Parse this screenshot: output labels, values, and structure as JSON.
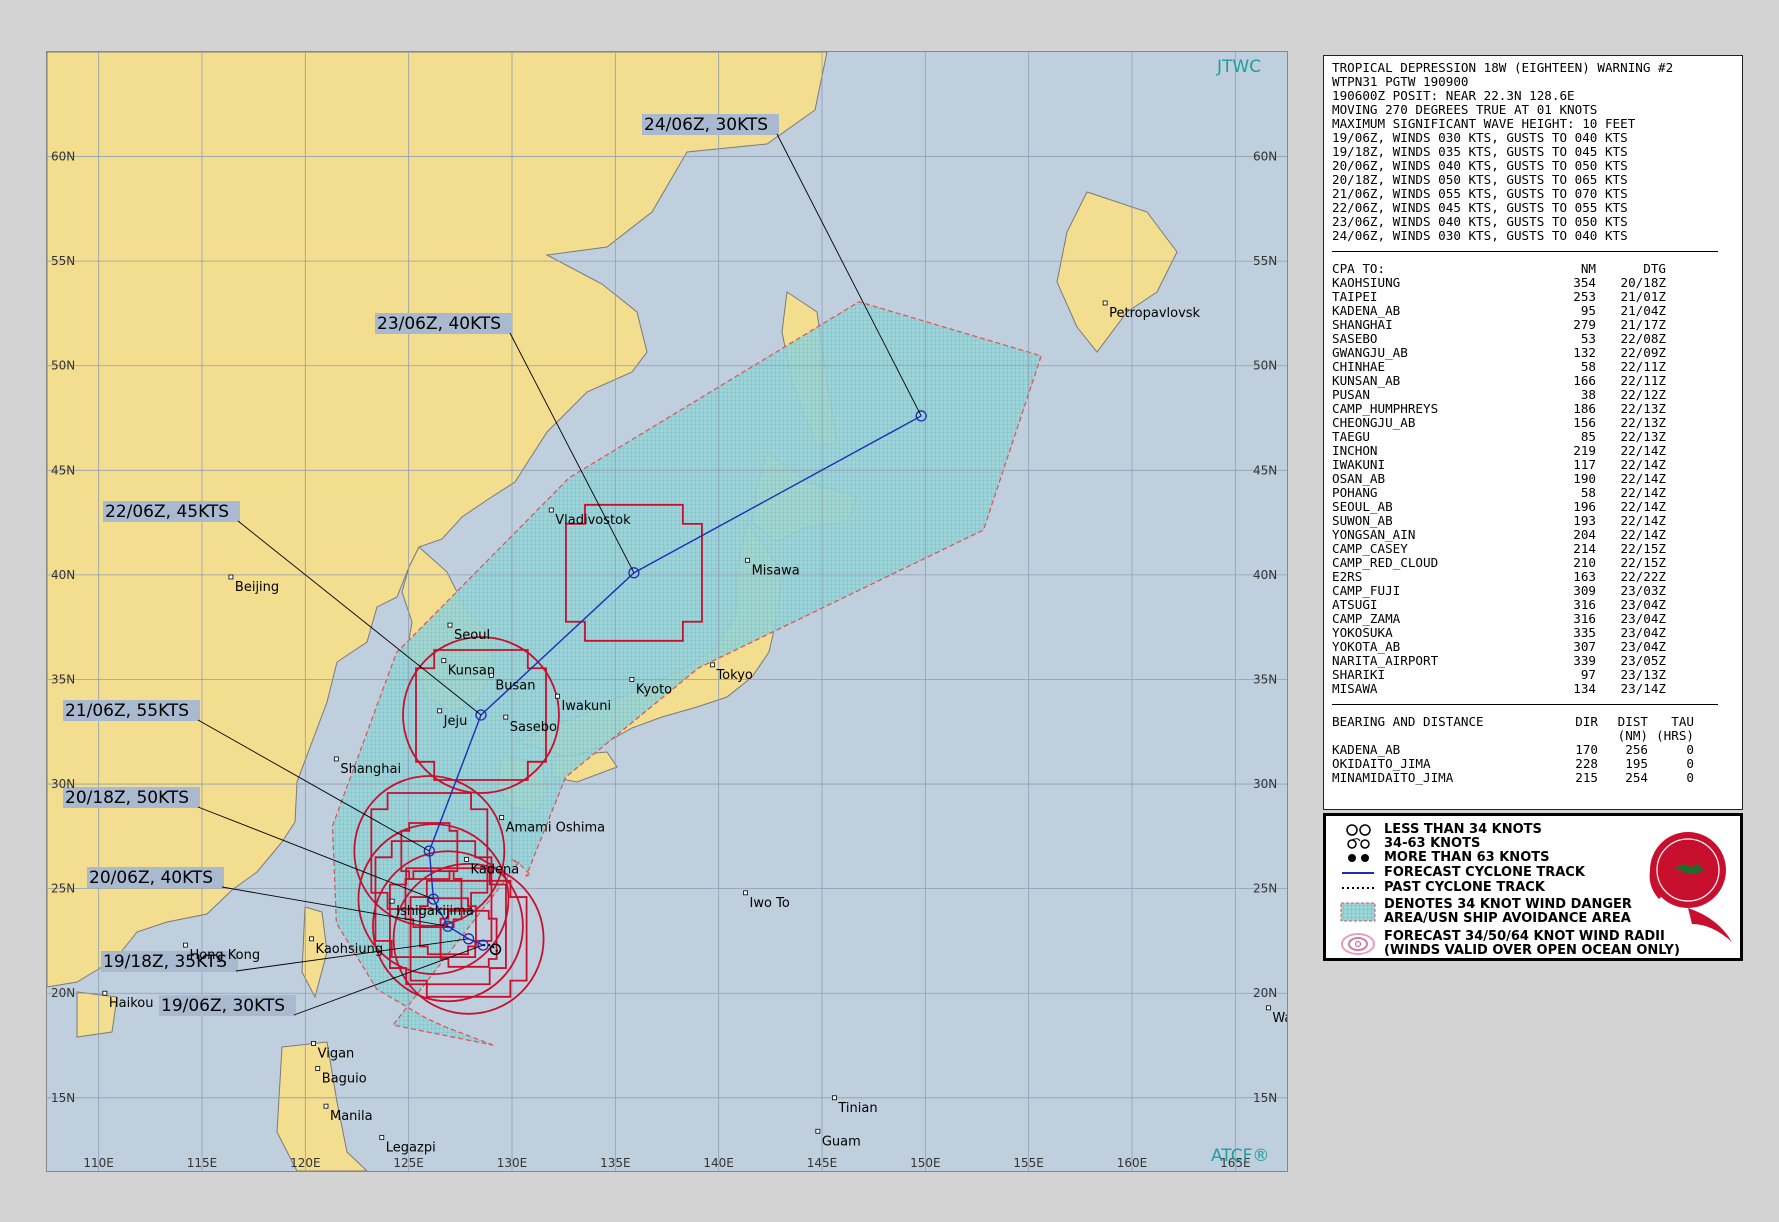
{
  "map": {
    "brand_top": "JTWC",
    "brand_bottom": "ATCF®",
    "lat_ticks": [
      {
        "lat": 60,
        "label": "60N"
      },
      {
        "lat": 55,
        "label": "55N"
      },
      {
        "lat": 50,
        "label": "50N"
      },
      {
        "lat": 45,
        "label": "45N"
      },
      {
        "lat": 40,
        "label": "40N"
      },
      {
        "lat": 35,
        "label": "35N"
      },
      {
        "lat": 30,
        "label": "30N"
      },
      {
        "lat": 25,
        "label": "25N"
      },
      {
        "lat": 20,
        "label": "20N"
      },
      {
        "lat": 15,
        "label": "15N"
      }
    ],
    "lon_ticks": [
      {
        "lon": 110,
        "label": "110E"
      },
      {
        "lon": 115,
        "label": "115E"
      },
      {
        "lon": 120,
        "label": "120E"
      },
      {
        "lon": 125,
        "label": "125E"
      },
      {
        "lon": 130,
        "label": "130E"
      },
      {
        "lon": 135,
        "label": "135E"
      },
      {
        "lon": 140,
        "label": "140E"
      },
      {
        "lon": 145,
        "label": "145E"
      },
      {
        "lon": 150,
        "label": "150E"
      },
      {
        "lon": 155,
        "label": "155E"
      },
      {
        "lon": 160,
        "label": "160E"
      },
      {
        "lon": 165,
        "label": "165E"
      }
    ],
    "cities": [
      {
        "name": "Petropavlovsk",
        "lon": 158.7,
        "lat": 53.0
      },
      {
        "name": "Vladivostok",
        "lon": 131.9,
        "lat": 43.1
      },
      {
        "name": "Beijing",
        "lon": 116.4,
        "lat": 39.9
      },
      {
        "name": "Misawa",
        "lon": 141.4,
        "lat": 40.7
      },
      {
        "name": "Seoul",
        "lon": 127.0,
        "lat": 37.6
      },
      {
        "name": "Kunsan",
        "lon": 126.7,
        "lat": 35.9
      },
      {
        "name": "Busan",
        "lon": 129.0,
        "lat": 35.2
      },
      {
        "name": "Kyoto",
        "lon": 135.8,
        "lat": 35.0
      },
      {
        "name": "Tokyo",
        "lon": 139.7,
        "lat": 35.7
      },
      {
        "name": "Jeju",
        "lon": 126.5,
        "lat": 33.5
      },
      {
        "name": "Sasebo",
        "lon": 129.7,
        "lat": 33.2
      },
      {
        "name": "Iwakuni",
        "lon": 132.2,
        "lat": 34.2
      },
      {
        "name": "Shanghai",
        "lon": 121.5,
        "lat": 31.2
      },
      {
        "name": "Amami Oshima",
        "lon": 129.5,
        "lat": 28.4
      },
      {
        "name": "Kadena",
        "lon": 127.8,
        "lat": 26.4
      },
      {
        "name": "Ishigakijima",
        "lon": 124.2,
        "lat": 24.4
      },
      {
        "name": "Iwo To",
        "lon": 141.3,
        "lat": 24.8
      },
      {
        "name": "Kaohsiung",
        "lon": 120.3,
        "lat": 22.6
      },
      {
        "name": "Hong Kong",
        "lon": 114.2,
        "lat": 22.3
      },
      {
        "name": "Haikou",
        "lon": 110.3,
        "lat": 20.0
      },
      {
        "name": "Wake",
        "lon": 166.6,
        "lat": 19.3
      },
      {
        "name": "Vigan",
        "lon": 120.4,
        "lat": 17.6
      },
      {
        "name": "Baguio",
        "lon": 120.6,
        "lat": 16.4
      },
      {
        "name": "Tinian",
        "lon": 145.6,
        "lat": 15.0
      },
      {
        "name": "Manila",
        "lon": 121.0,
        "lat": 14.6
      },
      {
        "name": "Guam",
        "lon": 144.8,
        "lat": 13.4
      },
      {
        "name": "Legazpi",
        "lon": 123.7,
        "lat": 13.1
      }
    ],
    "past_track": [
      {
        "lon": 129.3,
        "lat": 22.0
      },
      {
        "lon": 129.0,
        "lat": 22.3
      }
    ],
    "forecast_track": [
      {
        "time": "19/06Z",
        "lon": 128.6,
        "lat": 22.3,
        "intensity_kts": 30
      },
      {
        "time": "19/18Z",
        "lon": 127.9,
        "lat": 22.6,
        "intensity_kts": 35
      },
      {
        "time": "20/06Z",
        "lon": 126.9,
        "lat": 23.2,
        "intensity_kts": 40
      },
      {
        "time": "20/18Z",
        "lon": 126.2,
        "lat": 24.5,
        "intensity_kts": 50
      },
      {
        "time": "21/06Z",
        "lon": 126.0,
        "lat": 26.8,
        "intensity_kts": 55
      },
      {
        "time": "22/06Z",
        "lon": 128.5,
        "lat": 33.3,
        "intensity_kts": 45
      },
      {
        "time": "23/06Z",
        "lon": 135.9,
        "lat": 40.1,
        "intensity_kts": 40
      },
      {
        "time": "24/06Z",
        "lon": 149.8,
        "lat": 47.6,
        "intensity_kts": 30
      }
    ],
    "callouts": [
      {
        "text": "24/06Z,  30KTS",
        "anchor_lon": 149.8,
        "anchor_lat": 47.6
      },
      {
        "text": "23/06Z,  40KTS",
        "anchor_lon": 135.9,
        "anchor_lat": 40.1
      },
      {
        "text": "22/06Z,  45KTS",
        "anchor_lon": 128.5,
        "anchor_lat": 33.3
      },
      {
        "text": "21/06Z,  55KTS",
        "anchor_lon": 126.0,
        "anchor_lat": 26.8
      },
      {
        "text": "20/18Z,  50KTS",
        "anchor_lon": 126.2,
        "anchor_lat": 24.5
      },
      {
        "text": "20/06Z,  40KTS",
        "anchor_lon": 126.9,
        "anchor_lat": 23.2
      },
      {
        "text": "19/18Z,  35KTS",
        "anchor_lon": 127.9,
        "anchor_lat": 22.6
      },
      {
        "text": "19/06Z,  30KTS",
        "anchor_lon": 128.6,
        "anchor_lat": 22.3
      }
    ],
    "colors": {
      "ocean": "#bfcfde",
      "land": "#f3dd8f",
      "coast": "#7a7a7a",
      "grid": "#8f9fb2",
      "forecast_track": "#1f2bb8",
      "wind_radii": "#c8102e",
      "danger_area_fill": "#8fd2d6",
      "danger_area_edge": "#e05050"
    }
  },
  "warning": {
    "header": [
      "TROPICAL DEPRESSION 18W (EIGHTEEN) WARNING #2",
      "WTPN31 PGTW 190900",
      "190600Z POSIT: NEAR 22.3N 128.6E",
      "MOVING 270 DEGREES TRUE AT 01 KNOTS",
      "MAXIMUM SIGNIFICANT WAVE HEIGHT: 10 FEET",
      "19/06Z, WINDS 030 KTS, GUSTS TO 040 KTS",
      "19/18Z, WINDS 035 KTS, GUSTS TO 045 KTS",
      "20/06Z, WINDS 040 KTS, GUSTS TO 050 KTS",
      "20/18Z, WINDS 050 KTS, GUSTS TO 065 KTS",
      "21/06Z, WINDS 055 KTS, GUSTS TO 070 KTS",
      "22/06Z, WINDS 045 KTS, GUSTS TO 055 KTS",
      "23/06Z, WINDS 040 KTS, GUSTS TO 050 KTS",
      "24/06Z, WINDS 030 KTS, GUSTS TO 040 KTS"
    ],
    "cpa_header": {
      "name": "CPA TO:",
      "nm": "NM",
      "dtg": "DTG"
    },
    "cpa_rows": [
      {
        "name": "KAOHSIUNG",
        "nm": "354",
        "dtg": "20/18Z"
      },
      {
        "name": "TAIPEI",
        "nm": "253",
        "dtg": "21/01Z"
      },
      {
        "name": "KADENA_AB",
        "nm": "95",
        "dtg": "21/04Z"
      },
      {
        "name": "SHANGHAI",
        "nm": "279",
        "dtg": "21/17Z"
      },
      {
        "name": "SASEBO",
        "nm": "53",
        "dtg": "22/08Z"
      },
      {
        "name": "GWANGJU_AB",
        "nm": "132",
        "dtg": "22/09Z"
      },
      {
        "name": "CHINHAE",
        "nm": "58",
        "dtg": "22/11Z"
      },
      {
        "name": "KUNSAN_AB",
        "nm": "166",
        "dtg": "22/11Z"
      },
      {
        "name": "PUSAN",
        "nm": "38",
        "dtg": "22/12Z"
      },
      {
        "name": "CAMP_HUMPHREYS",
        "nm": "186",
        "dtg": "22/13Z"
      },
      {
        "name": "CHEONGJU_AB",
        "nm": "156",
        "dtg": "22/13Z"
      },
      {
        "name": "TAEGU",
        "nm": "85",
        "dtg": "22/13Z"
      },
      {
        "name": "INCHON",
        "nm": "219",
        "dtg": "22/14Z"
      },
      {
        "name": "IWAKUNI",
        "nm": "117",
        "dtg": "22/14Z"
      },
      {
        "name": "OSAN_AB",
        "nm": "190",
        "dtg": "22/14Z"
      },
      {
        "name": "POHANG",
        "nm": "58",
        "dtg": "22/14Z"
      },
      {
        "name": "SEOUL_AB",
        "nm": "196",
        "dtg": "22/14Z"
      },
      {
        "name": "SUWON_AB",
        "nm": "193",
        "dtg": "22/14Z"
      },
      {
        "name": "YONGSAN_AIN",
        "nm": "204",
        "dtg": "22/14Z"
      },
      {
        "name": "CAMP_CASEY",
        "nm": "214",
        "dtg": "22/15Z"
      },
      {
        "name": "CAMP_RED_CLOUD",
        "nm": "210",
        "dtg": "22/15Z"
      },
      {
        "name": "E2RS",
        "nm": "163",
        "dtg": "22/22Z"
      },
      {
        "name": "CAMP_FUJI",
        "nm": "309",
        "dtg": "23/03Z"
      },
      {
        "name": "ATSUGI",
        "nm": "316",
        "dtg": "23/04Z"
      },
      {
        "name": "CAMP_ZAMA",
        "nm": "316",
        "dtg": "23/04Z"
      },
      {
        "name": "YOKOSUKA",
        "nm": "335",
        "dtg": "23/04Z"
      },
      {
        "name": "YOKOTA_AB",
        "nm": "307",
        "dtg": "23/04Z"
      },
      {
        "name": "NARITA_AIRPORT",
        "nm": "339",
        "dtg": "23/05Z"
      },
      {
        "name": "SHARIKI",
        "nm": "97",
        "dtg": "23/13Z"
      },
      {
        "name": "MISAWA",
        "nm": "134",
        "dtg": "23/14Z"
      }
    ],
    "bd_header": {
      "name": "BEARING AND DISTANCE",
      "dir": "DIR",
      "dist": "DIST",
      "tau": "TAU"
    },
    "bd_units": {
      "dist": "(NM)",
      "tau": "(HRS)"
    },
    "bd_rows": [
      {
        "name": "KADENA_AB",
        "dir": "170",
        "dist": "256",
        "tau": "0"
      },
      {
        "name": "OKIDAITO_JIMA",
        "dir": "228",
        "dist": "195",
        "tau": "0"
      },
      {
        "name": "MINAMIDAITO_JIMA",
        "dir": "215",
        "dist": "254",
        "tau": "0"
      }
    ]
  },
  "legend": {
    "items": [
      "LESS THAN 34 KNOTS",
      "34-63 KNOTS",
      "MORE THAN 63 KNOTS",
      "FORECAST CYCLONE TRACK",
      "PAST CYCLONE TRACK",
      "DENOTES 34 KNOT WIND DANGER",
      "AREA/USN SHIP AVOIDANCE AREA",
      "FORECAST 34/50/64 KNOT WIND RADII",
      "(WINDS VALID OVER OPEN OCEAN ONLY)"
    ]
  }
}
